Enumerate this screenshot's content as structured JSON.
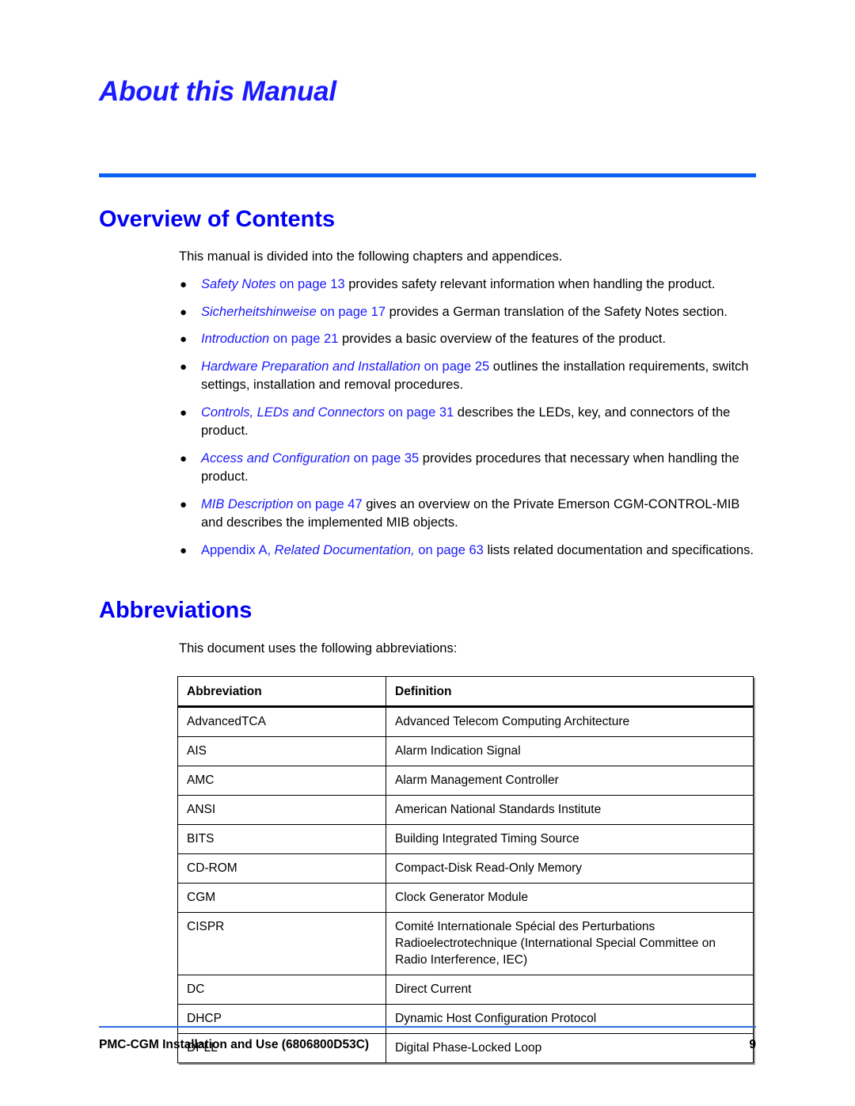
{
  "document": {
    "chapter_title": "About this Manual",
    "footer_text": "PMC-CGM Installation and Use (6806800D53C)",
    "page_number": "9",
    "accent_color": "#0000f5",
    "link_color": "#1a1aff",
    "rule_color": "#0a62f0"
  },
  "overview": {
    "heading": "Overview of Contents",
    "intro": "This manual is divided into the following chapters and appendices.",
    "bullets": [
      {
        "lead_plain": "",
        "xref_title": "Safety Notes",
        "xref_page": " on page 13",
        "rest": " provides safety relevant information when handling the product."
      },
      {
        "lead_plain": "",
        "xref_title": "Sicherheitshinweise",
        "xref_page": " on page 17",
        "rest": " provides a German translation of the Safety Notes section."
      },
      {
        "lead_plain": "",
        "xref_title": "Introduction",
        "xref_page": " on page 21",
        "rest": " provides a basic overview of the features of the product."
      },
      {
        "lead_plain": "",
        "xref_title": "Hardware Preparation and Installation",
        "xref_page": " on page 25",
        "rest": " outlines the installation requirements, switch settings, installation and removal procedures."
      },
      {
        "lead_plain": "",
        "xref_title": "Controls, LEDs and Connectors",
        "xref_page": " on page 31",
        "rest": " describes the LEDs, key, and connectors of the product."
      },
      {
        "lead_plain": "",
        "xref_title": "Access and Configuration",
        "xref_page": " on page 35",
        "rest": " provides procedures that necessary when handling the product."
      },
      {
        "lead_plain": "",
        "xref_title": "MIB Description",
        "xref_page": " on page 47",
        "rest": " gives an overview on the Private Emerson CGM-CONTROL-MIB and describes the implemented MIB objects."
      },
      {
        "lead_plain": "Appendix A, ",
        "xref_title": "Related Documentation,",
        "xref_page": " on page 63",
        "rest": " lists related documentation and specifications."
      }
    ]
  },
  "abbreviations": {
    "heading": "Abbreviations",
    "intro": "This document uses the following abbreviations:",
    "columns": [
      "Abbreviation",
      "Definition"
    ],
    "rows": [
      [
        "AdvancedTCA",
        "Advanced Telecom Computing Architecture"
      ],
      [
        "AIS",
        "Alarm Indication Signal"
      ],
      [
        "AMC",
        "Alarm Management Controller"
      ],
      [
        "ANSI",
        "American National Standards Institute"
      ],
      [
        "BITS",
        "Building Integrated Timing Source"
      ],
      [
        "CD-ROM",
        "Compact-Disk Read-Only Memory"
      ],
      [
        "CGM",
        "Clock Generator Module"
      ],
      [
        "CISPR",
        "Comité Internationale Spécial des Perturbations Radioelectrotechnique (International Special Committee on Radio Interference, IEC)"
      ],
      [
        "DC",
        "Direct Current"
      ],
      [
        "DHCP",
        "Dynamic Host Configuration Protocol"
      ],
      [
        "DPLL",
        "Digital Phase-Locked Loop"
      ]
    ]
  }
}
